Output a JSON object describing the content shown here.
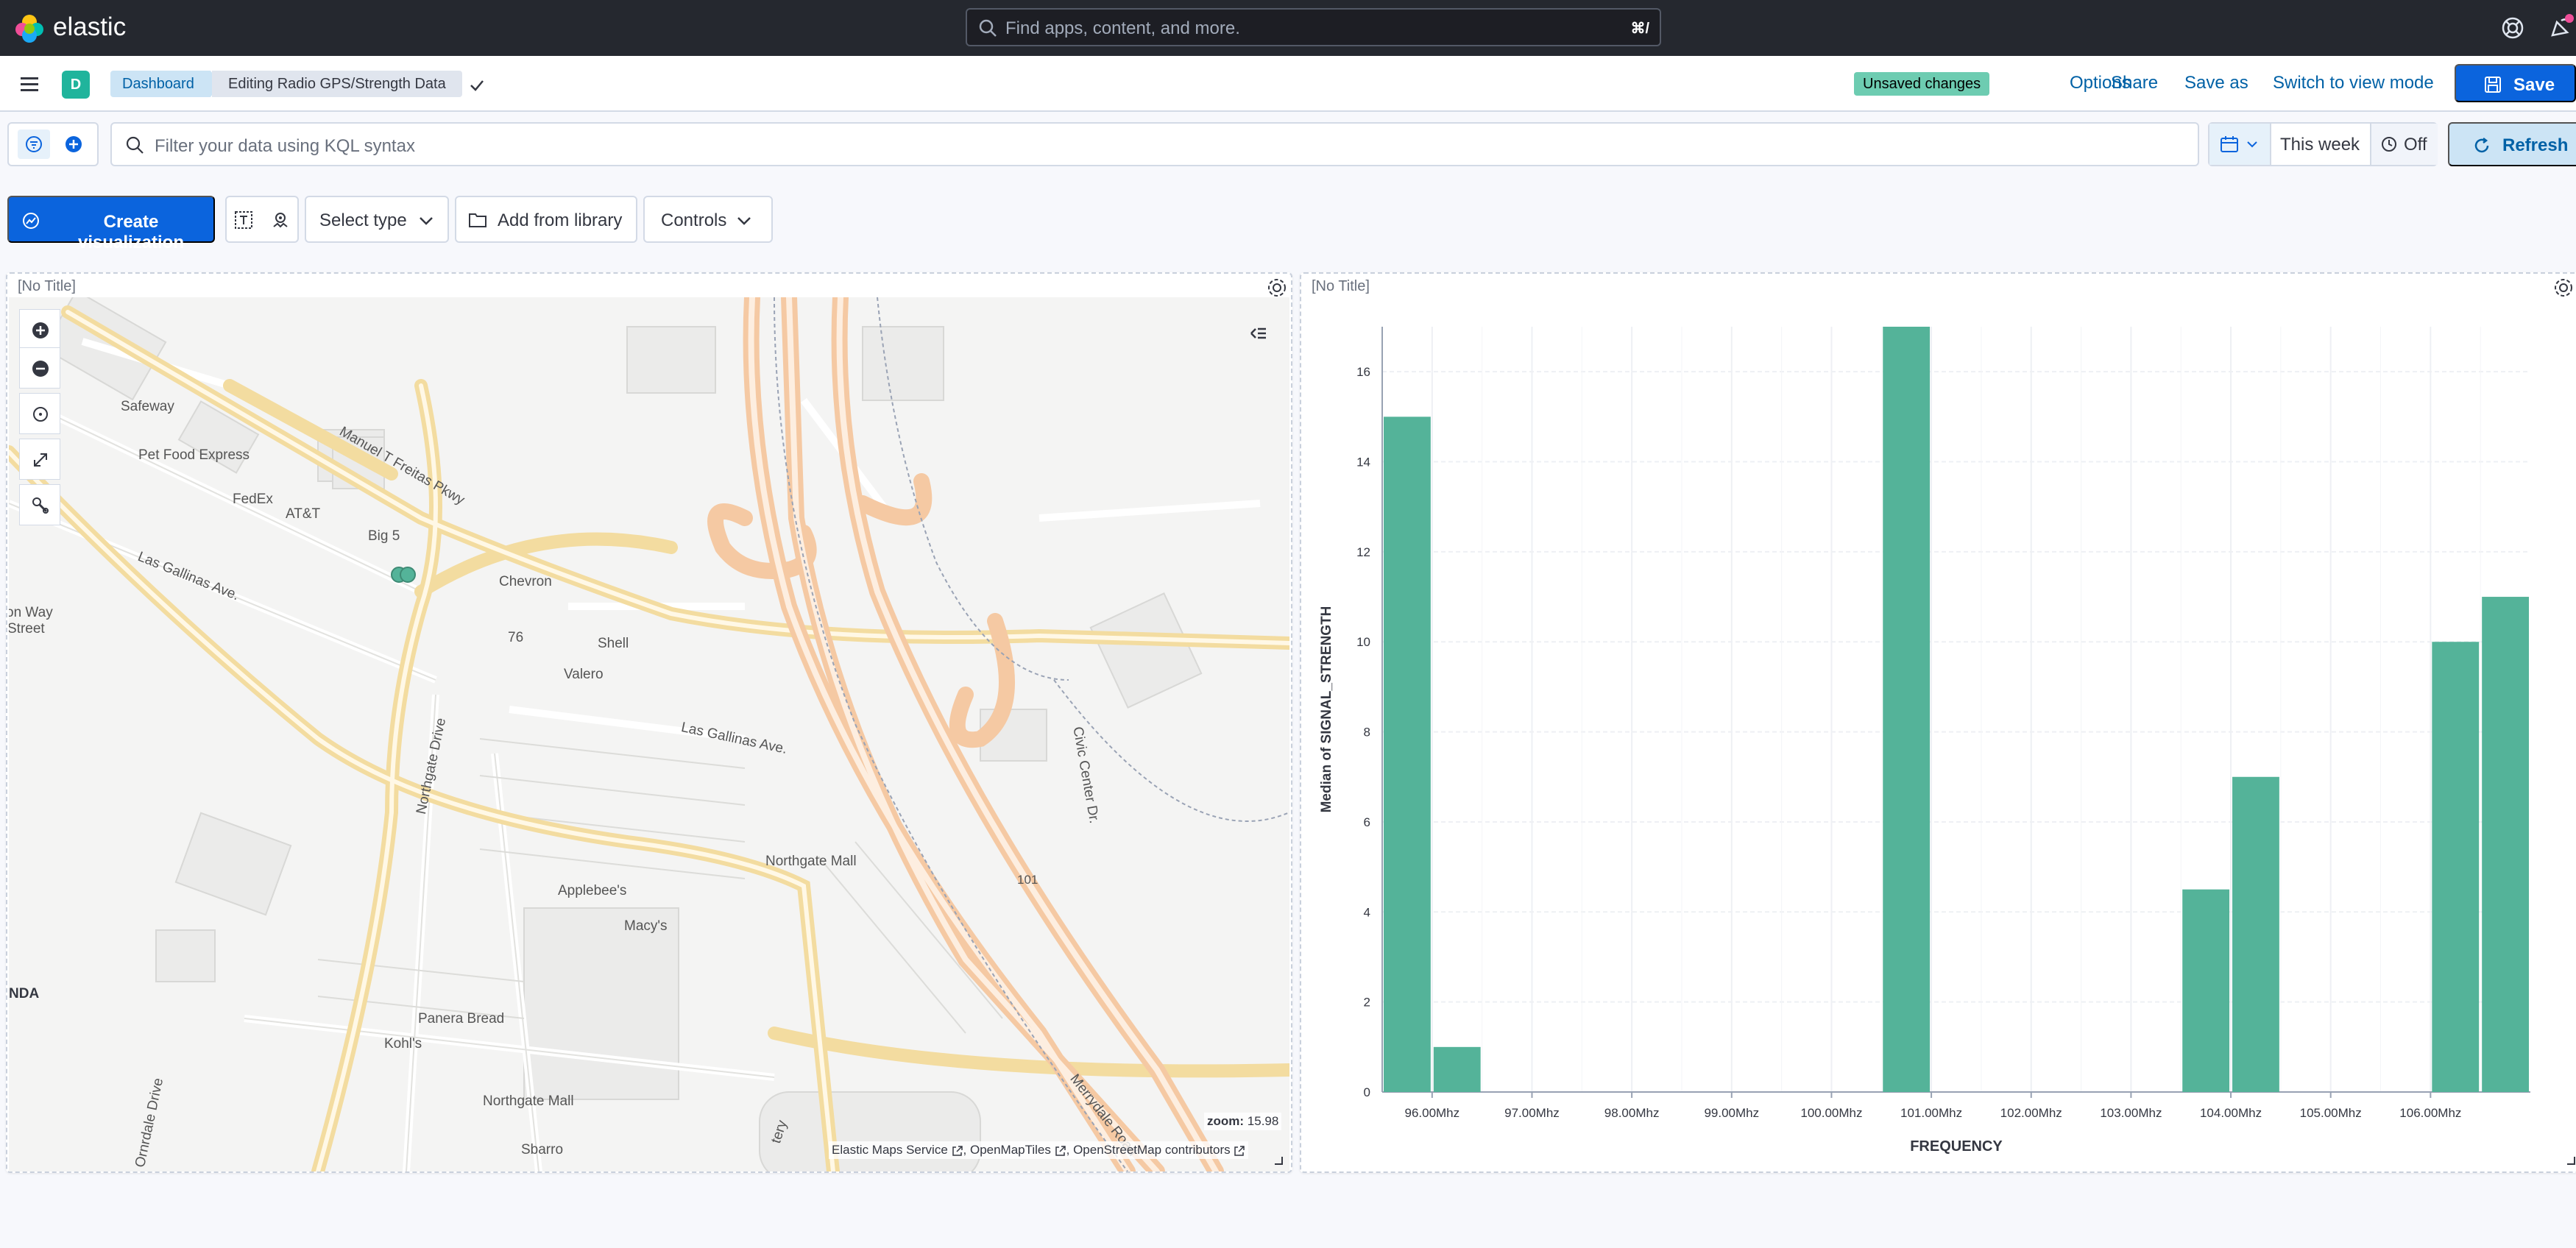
{
  "brand": {
    "name": "elastic"
  },
  "global_search": {
    "placeholder": "Find apps, content, and more.",
    "shortcut": "⌘/"
  },
  "header": {
    "space_initial": "D",
    "breadcrumbs": [
      {
        "label": "Dashboard"
      },
      {
        "label": "Editing Radio GPS/Strength Data"
      }
    ],
    "unsaved_badge": "Unsaved changes",
    "actions": {
      "options": "Options",
      "share": "Share",
      "save_as": "Save as",
      "switch_mode": "Switch to view mode",
      "save": "Save"
    }
  },
  "query_bar": {
    "placeholder": "Filter your data using KQL syntax",
    "date_label": "This week",
    "auto_refresh": "Off",
    "refresh": "Refresh"
  },
  "toolbar": {
    "create_visualization": "Create visualization",
    "select_type": "Select type",
    "add_from_library": "Add from library",
    "controls": "Controls"
  },
  "panels": {
    "map": {
      "title": "[No Title]",
      "labels": {
        "safeway": "Safeway",
        "pet_food": "Pet Food Express",
        "fedex": "FedEx",
        "att": "AT&T",
        "big5": "Big 5",
        "manuel": "Manuel T Freitas Pkwy",
        "las_gallinas_1": "Las Gallinas Ave.",
        "on_way": "on Way",
        "street": "Street",
        "chevron": "Chevron",
        "rt76": "76",
        "shell": "Shell",
        "valero": "Valero",
        "las_gallinas_2": "Las Gallinas Ave.",
        "northgate_dr": "Northgate Drive",
        "civic": "Civic Center Dr.",
        "northgate_mall_1": "Northgate Mall",
        "applebees": "Applebee's",
        "macys": "Macy's",
        "rt101": "101",
        "nda": "NDA",
        "panera": "Panera Bread",
        "kohls": "Kohl's",
        "northgate_mall_2": "Northgate Mall",
        "sbarro": "Sbarro",
        "merrydale": "Merrydale Road",
        "ornrdale": "Ornrdale Drive",
        "tery": "tery"
      },
      "zoom_label": "zoom:",
      "zoom_value": "15.98",
      "attribution": {
        "ems": "Elastic Maps Service",
        "omt": "OpenMapTiles",
        "osm": "OpenStreetMap contributors"
      }
    },
    "chart": {
      "title": "[No Title]"
    }
  },
  "colors": {
    "bar": "#54b399",
    "primary": "#0b64dd",
    "header_bg": "#25282f",
    "accent_badge": "#6dccb1"
  },
  "chart_data": {
    "type": "bar",
    "title": "",
    "xlabel": "FREQUENCY",
    "ylabel": "Median of SIGNAL_STRENGTH",
    "ylim": [
      0,
      17
    ],
    "y_ticks": [
      "0",
      "2",
      "4",
      "6",
      "8",
      "10",
      "12",
      "14",
      "16"
    ],
    "x_ticks": [
      "96.00Mhz",
      "97.00Mhz",
      "98.00Mhz",
      "99.00Mhz",
      "100.00Mhz",
      "101.00Mhz",
      "102.00Mhz",
      "103.00Mhz",
      "104.00Mhz",
      "105.00Mhz",
      "106.00Mhz"
    ],
    "x_tick_values": [
      96,
      97,
      98,
      99,
      100,
      101,
      102,
      103,
      104,
      105,
      106
    ],
    "xlim": [
      95.5,
      107.0
    ],
    "bar_width": 0.5,
    "bars": [
      {
        "x": 95.5,
        "value": 15
      },
      {
        "x": 96.0,
        "value": 1
      },
      {
        "x": 100.5,
        "value": 17
      },
      {
        "x": 103.5,
        "value": 4.5
      },
      {
        "x": 104.0,
        "value": 7
      },
      {
        "x": 106.0,
        "value": 10
      },
      {
        "x": 106.5,
        "value": 11
      }
    ],
    "grid": true
  }
}
